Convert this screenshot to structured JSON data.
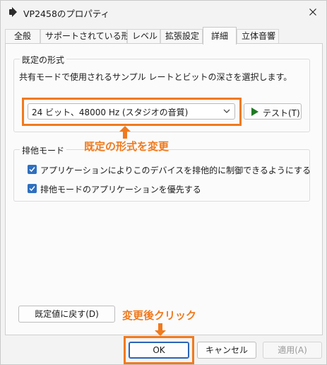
{
  "window": {
    "title": "VP2458のプロパティ"
  },
  "tabs": [
    {
      "label": "全般"
    },
    {
      "label": "サポートされている形式"
    },
    {
      "label": "レベル"
    },
    {
      "label": "拡張設定"
    },
    {
      "label": "詳細"
    },
    {
      "label": "立体音響"
    }
  ],
  "default_format": {
    "group_label": "既定の形式",
    "description": "共有モードで使用されるサンプル レートとビットの深さを選択します。",
    "selected": "24 ビット、48000 Hz (スタジオの音質)",
    "test_button": "テスト(T)"
  },
  "exclusive_mode": {
    "group_label": "排他モード",
    "options": [
      {
        "label": "アプリケーションによりこのデバイスを排他的に制御できるようにする",
        "checked": true
      },
      {
        "label": "排他モードのアプリケーションを優先する",
        "checked": true
      }
    ]
  },
  "restore_button": "既定値に戻す(D)",
  "annotations": {
    "format_hint": "既定の形式を変更",
    "ok_hint": "変更後クリック",
    "color": "#f07a1e"
  },
  "footer": {
    "ok": "OK",
    "cancel": "キャンセル",
    "apply": "適用(A)"
  }
}
